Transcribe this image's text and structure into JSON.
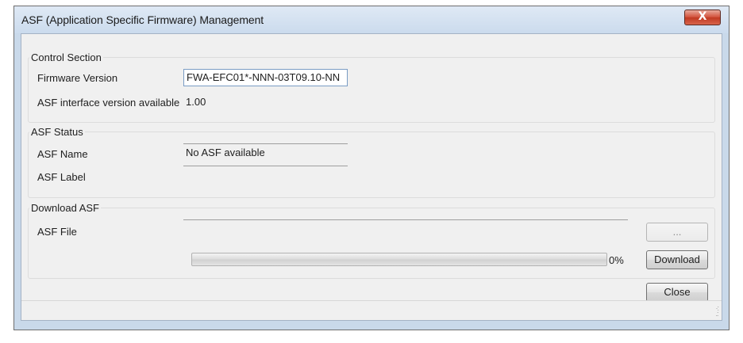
{
  "window": {
    "title": "ASF (Application Specific Firmware) Management",
    "close_icon": "close-icon",
    "close_glyph": "X"
  },
  "control_section": {
    "legend": "Control Section",
    "firmware_version_label": "Firmware Version",
    "firmware_version_value": "FWA-EFC01*-NNN-03T09.10-NN",
    "asf_interface_label": "ASF interface version available",
    "asf_interface_value": "1.00"
  },
  "asf_status": {
    "legend": "ASF Status",
    "asf_name_label": "ASF Name",
    "asf_name_value": "No ASF available",
    "asf_label_label": "ASF Label",
    "asf_label_value": ""
  },
  "download_asf": {
    "legend": "Download ASF",
    "asf_file_label": "ASF File",
    "asf_file_value": "",
    "browse_label": "...",
    "progress_percent": 0,
    "progress_text": "0%",
    "download_label": "Download"
  },
  "footer": {
    "close_label": "Close",
    "resize_grip_icon": "resize-grip-icon"
  },
  "colors": {
    "title_gradient": "#cbdbed",
    "close_button": "#c03a22",
    "progress_fill": "#36c236"
  }
}
